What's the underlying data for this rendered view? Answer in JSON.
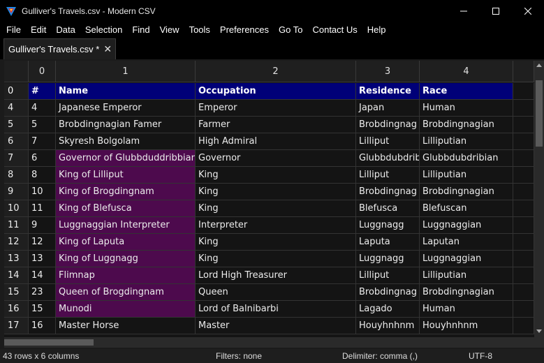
{
  "window": {
    "title": "Gulliver's Travels.csv - Modern CSV",
    "icon": "modern-csv-logo-icon",
    "controls": [
      "minimize-icon",
      "maximize-icon",
      "close-icon"
    ]
  },
  "menu": [
    "File",
    "Edit",
    "Data",
    "Selection",
    "Find",
    "View",
    "Tools",
    "Preferences",
    "Go To",
    "Contact Us",
    "Help"
  ],
  "tab": {
    "label": "Gulliver's Travels.csv *",
    "close": "✕"
  },
  "colors": {
    "header_row_bg": "#000078",
    "selection_bg": "#4d0a4d",
    "background": "#141414"
  },
  "grid": {
    "column_headers": [
      "0",
      "1",
      "2",
      "3",
      "4"
    ],
    "header_row": {
      "index": "0",
      "cells": [
        "#",
        "Name",
        "Occupation",
        "Residence",
        "Race"
      ]
    },
    "rows": [
      {
        "index": "4",
        "cells": [
          "4",
          "Japanese Emperor",
          "Emperor",
          "Japan",
          "Human"
        ],
        "selected": false
      },
      {
        "index": "5",
        "cells": [
          "5",
          "Brobdingnagian Famer",
          "Farmer",
          "Brobdingnag",
          "Brobdingnagian"
        ],
        "selected": false
      },
      {
        "index": "6",
        "cells": [
          "7",
          "Skyresh Bolgolam",
          "High Admiral",
          "Lilliput",
          "Lilliputian"
        ],
        "selected": false
      },
      {
        "index": "7",
        "cells": [
          "6",
          "Governor of Glubbduddribbian",
          "Governor",
          "Glubbdubdrib",
          "Glubbdubdribian"
        ],
        "selected": true
      },
      {
        "index": "8",
        "cells": [
          "8",
          "King of Lilliput",
          "King",
          "Lilliput",
          "Lilliputian"
        ],
        "selected": true
      },
      {
        "index": "9",
        "cells": [
          "10",
          "King of Brogdingnam",
          "King",
          "Brobdingnag",
          "Brobdingnagian"
        ],
        "selected": true
      },
      {
        "index": "10",
        "cells": [
          "11",
          "King of Blefusca",
          "King",
          "Blefusca",
          "Blefuscan"
        ],
        "selected": true
      },
      {
        "index": "11",
        "cells": [
          "9",
          "Luggnaggian Interpreter",
          "Interpreter",
          "Luggnagg",
          "Luggnaggian"
        ],
        "selected": true
      },
      {
        "index": "12",
        "cells": [
          "12",
          "King of Laputa",
          "King",
          "Laputa",
          "Laputan"
        ],
        "selected": true
      },
      {
        "index": "13",
        "cells": [
          "13",
          "King of Luggnagg",
          "King",
          "Luggnagg",
          "Luggnaggian"
        ],
        "selected": true
      },
      {
        "index": "14",
        "cells": [
          "14",
          "Flimnap",
          "Lord High Treasurer",
          "Lilliput",
          "Lilliputian"
        ],
        "selected": true
      },
      {
        "index": "15",
        "cells": [
          "23",
          "Queen of Brogdingnam",
          "Queen",
          "Brobdingnag",
          "Brobdingnagian"
        ],
        "selected": true
      },
      {
        "index": "16",
        "cells": [
          "15",
          "Munodi",
          "Lord of Balnibarbi",
          "Lagado",
          "Human"
        ],
        "selected": true
      },
      {
        "index": "17",
        "cells": [
          "16",
          "Master Horse",
          "Master",
          "Houyhnhnm",
          "Houyhnhnm"
        ],
        "selected": false
      }
    ]
  },
  "status": {
    "dimensions": "43 rows x 6 columns",
    "filters": "Filters: none",
    "delimiter": "Delimiter: comma (,)",
    "encoding": "UTF-8"
  }
}
